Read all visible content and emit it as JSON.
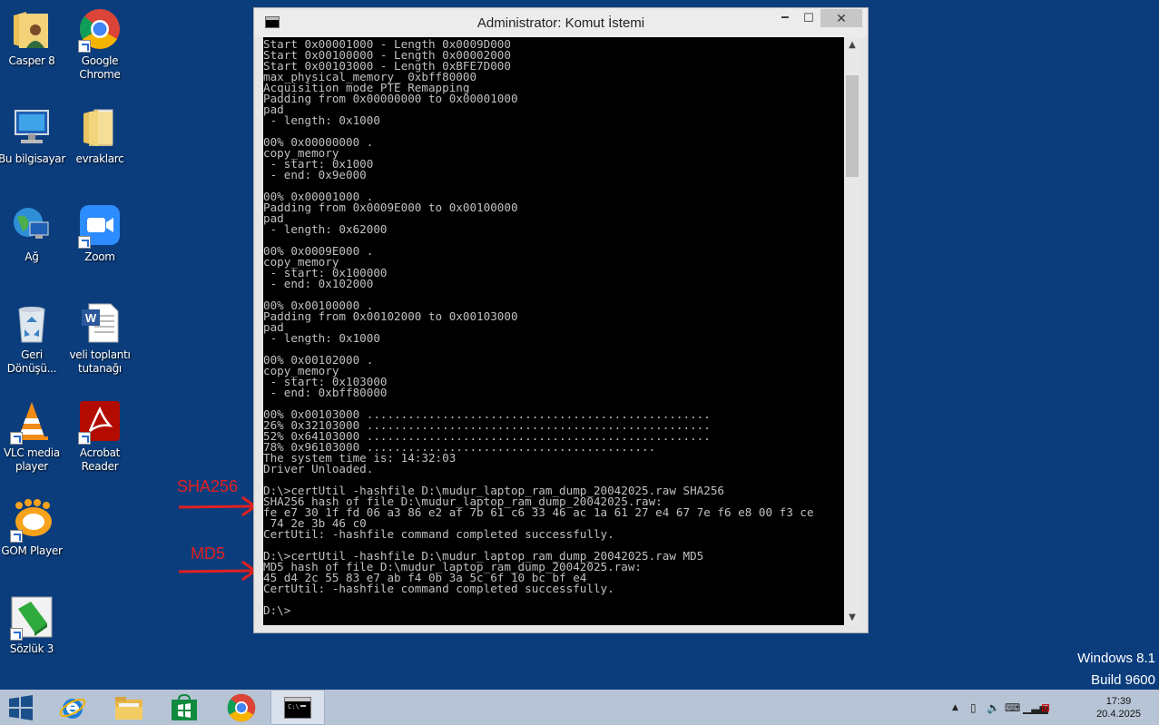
{
  "desktop": {
    "icons": [
      {
        "label": "Casper 8"
      },
      {
        "label": "Google\nChrome"
      },
      {
        "label": "Bu bilgisayar"
      },
      {
        "label": "evraklarc"
      },
      {
        "label": "Ağ"
      },
      {
        "label": "Zoom"
      },
      {
        "label": "Geri\nDönüşü..."
      },
      {
        "label": "veli toplantı\ntutanağı"
      },
      {
        "label": "VLC media\nplayer"
      },
      {
        "label": "Acrobat\nReader"
      },
      {
        "label": "GOM Player"
      },
      {
        "label": "Sözlük 3"
      }
    ],
    "annotations": {
      "sha": "SHA256",
      "md5": "MD5"
    },
    "watermark": {
      "line1": "Windows 8.1",
      "line2": "Build 9600"
    }
  },
  "window": {
    "title": "Administrator: Komut İstemi",
    "minimize": "🗕",
    "maximize": "☐",
    "close": "✕",
    "console_lines": [
      "Start 0x00001000 - Length 0x0009D000",
      "Start 0x00100000 - Length 0x00002000",
      "Start 0x00103000 - Length 0xBFE7D000",
      "max_physical_memory_ 0xbff80000",
      "Acquisition mode PTE Remapping",
      "Padding from 0x00000000 to 0x00001000",
      "pad",
      " - length: 0x1000",
      "",
      "00% 0x00000000 .",
      "copy_memory",
      " - start: 0x1000",
      " - end: 0x9e000",
      "",
      "00% 0x00001000 .",
      "Padding from 0x0009E000 to 0x00100000",
      "pad",
      " - length: 0x62000",
      "",
      "00% 0x0009E000 .",
      "copy_memory",
      " - start: 0x100000",
      " - end: 0x102000",
      "",
      "00% 0x00100000 .",
      "Padding from 0x00102000 to 0x00103000",
      "pad",
      " - length: 0x1000",
      "",
      "00% 0x00102000 .",
      "copy_memory",
      " - start: 0x103000",
      " - end: 0xbff80000",
      "",
      "00% 0x00103000 ..................................................",
      "26% 0x32103000 ..................................................",
      "52% 0x64103000 ..................................................",
      "78% 0x96103000 ..........................................",
      "The system time is: 14:32:03",
      "Driver Unloaded.",
      "",
      "D:\\>certUtil -hashfile D:\\mudur_laptop_ram_dump_20042025.raw SHA256",
      "SHA256 hash of file D:\\mudur_laptop_ram_dump_20042025.raw:",
      "fe e7 30 1f fd 06 a3 86 e2 af 7b 61 c6 33 46 ac 1a 61 27 e4 67 7e f6 e8 00 f3 ce",
      " 74 2e 3b 46 c0",
      "CertUtil: -hashfile command completed successfully.",
      "",
      "D:\\>certUtil -hashfile D:\\mudur_laptop_ram_dump_20042025.raw MD5",
      "MD5 hash of file D:\\mudur_laptop_ram_dump_20042025.raw:",
      "45 d4 2c 55 83 e7 ab f4 0b 3a 5c 6f 10 bc bf e4",
      "CertUtil: -hashfile command completed successfully.",
      "",
      "D:\\>"
    ]
  },
  "taskbar": {
    "items": [
      "start-button",
      "internet-explorer",
      "file-explorer",
      "windows-store",
      "google-chrome",
      "command-prompt"
    ],
    "clock": {
      "time": "17:39",
      "date": "20.4.2025"
    }
  }
}
